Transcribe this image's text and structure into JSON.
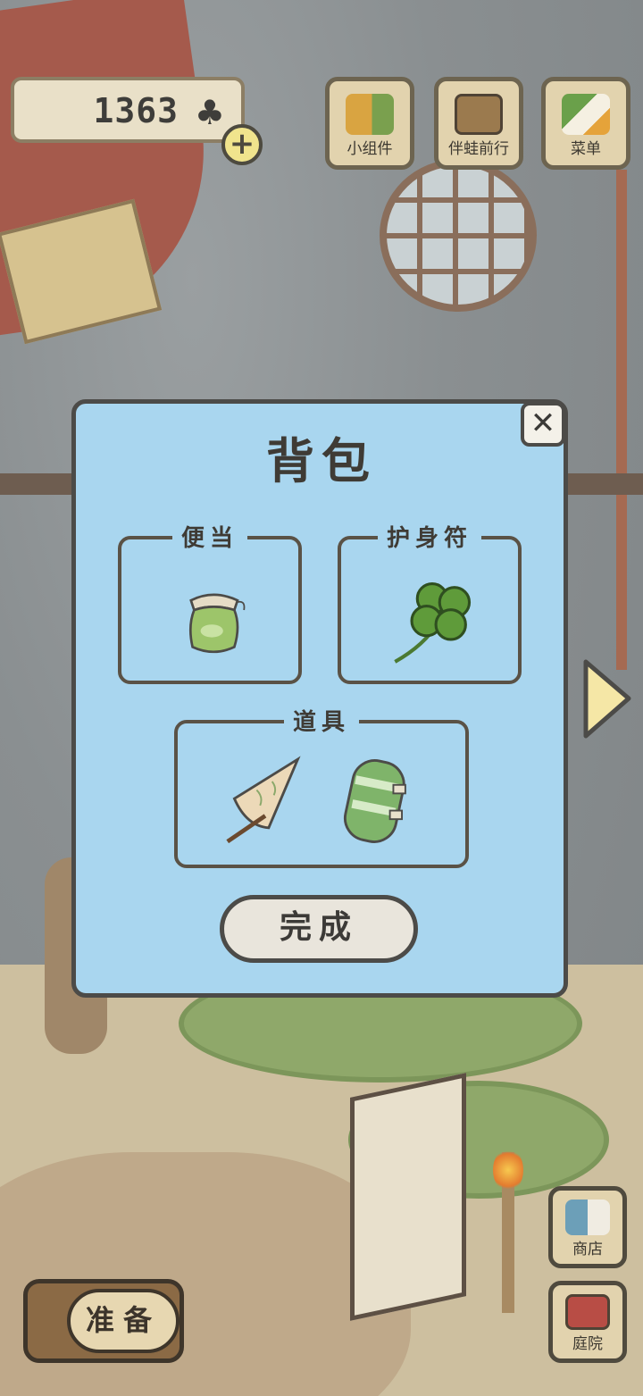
{
  "hud": {
    "clover_count": "1363",
    "clover_icon": "clover-icon",
    "plus_icon": "plus-icon",
    "plus_symbol": "+"
  },
  "top_buttons": [
    {
      "label": "小组件",
      "icon": "house-widget-icon"
    },
    {
      "label": "伴蛙前行",
      "icon": "album-icon"
    },
    {
      "label": "菜单",
      "icon": "menu-icon"
    }
  ],
  "side_buttons": [
    {
      "label": "商店",
      "icon": "shop-bags-icon"
    },
    {
      "label": "庭院",
      "icon": "yard-mailbox-icon"
    }
  ],
  "prepare_label": "准备",
  "dialog": {
    "title": "背包",
    "close_symbol": "✕",
    "sections": {
      "lunch": {
        "label": "便当",
        "items": [
          "jar-icon"
        ]
      },
      "charm": {
        "label": "护身符",
        "items": [
          "four-leaf-clover-icon"
        ]
      },
      "tools": {
        "label": "道具",
        "items": [
          "umbrella-icon",
          "sleeping-roll-icon"
        ]
      }
    },
    "done_label": "完成"
  },
  "colors": {
    "dialog_bg": "#a9d6ef",
    "frame_border": "#5a5246",
    "button_bg": "#e9e5dc"
  }
}
